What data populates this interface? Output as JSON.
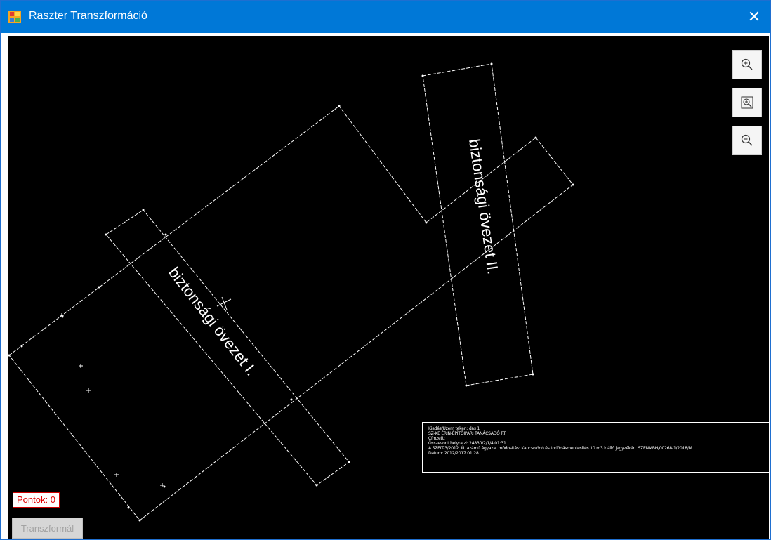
{
  "window": {
    "title": "Raszter Transzformáció",
    "close_glyph": "✕",
    "titlebar_color": "#0078d7"
  },
  "toolbar": {
    "zoom_in_icon": "zoom-in-icon",
    "zoom_fit_icon": "zoom-extent-icon",
    "zoom_out_icon": "zoom-out-icon"
  },
  "drawing": {
    "label_zone_1": "biztonsági övezet I.",
    "label_zone_2": "biztonsági övezet II.",
    "line_color": "#ffffff",
    "background_color": "#000000"
  },
  "info_box": {
    "lines": [
      "Kiadás/Üzem teken: dás 1",
      "SZ-KE ÉRIN-ÉPÍTŐIPARI TANÁCSADÓ RT.",
      "Címzett:",
      "Összevont helyrajzi: 24830/2/1/4 01:31",
      "A SZEIT-3/2012. III. azámú ágyazat módosítás: Kapcsolódó és torlódásmentesítés 10 m3 kiálló jegyzékén. SZENMBH/00268-1/2018/M",
      "Dátum: 2012/2017 01:28"
    ]
  },
  "status": {
    "points_label": "Pontok: 0",
    "points_color": "#e00000"
  },
  "buttons": {
    "transform_label": "Transzformál"
  }
}
